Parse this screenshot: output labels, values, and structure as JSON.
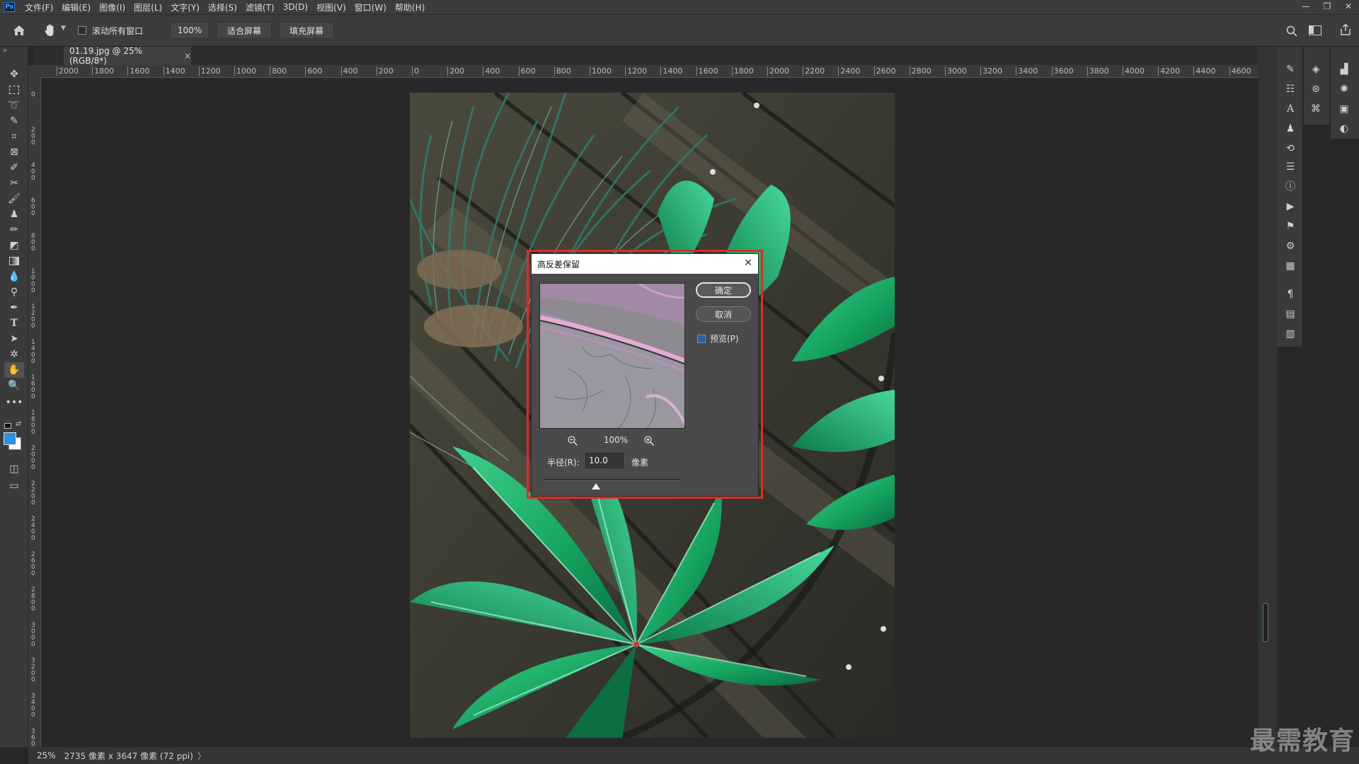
{
  "app": {
    "logo": "Ps"
  },
  "menu": [
    "文件(F)",
    "编辑(E)",
    "图像(I)",
    "图层(L)",
    "文字(Y)",
    "选择(S)",
    "滤镜(T)",
    "3D(D)",
    "视图(V)",
    "窗口(W)",
    "帮助(H)"
  ],
  "window_controls": {
    "minimize": "—",
    "restore": "❐",
    "close": "✕"
  },
  "options": {
    "scroll_all_label": "滚动所有窗口",
    "scroll_all_checked": false,
    "zoom_value": "100%",
    "fit_screen": "适合屏幕",
    "fill_screen": "填充屏幕"
  },
  "document": {
    "tab_title": "01.19.jpg @ 25%(RGB/8*)",
    "tab_close": "×"
  },
  "h_ruler_labels": [
    "2000",
    "1800",
    "1600",
    "1400",
    "1200",
    "1000",
    "800",
    "600",
    "400",
    "200",
    "0",
    "200",
    "400",
    "600",
    "800",
    "1000",
    "1200",
    "1400",
    "1600",
    "1800",
    "2000",
    "2200",
    "2400",
    "2600",
    "2800",
    "3000",
    "3200",
    "3400",
    "3600",
    "3800",
    "4000",
    "4200",
    "4400",
    "4600"
  ],
  "v_ruler_labels": [
    "0",
    "200",
    "400",
    "600",
    "800",
    "1000",
    "1200",
    "1400",
    "1600",
    "1800",
    "2000",
    "2200",
    "2400",
    "2600",
    "2800",
    "3000",
    "3200",
    "3400",
    "3600"
  ],
  "status": {
    "zoom": "25%",
    "info": "2735 像素 x 3647 像素 (72 ppi)",
    "arrow": "〉"
  },
  "dialog": {
    "title": "高反差保留",
    "close": "✕",
    "ok": "确定",
    "cancel": "取消",
    "preview_label": "预览(P)",
    "preview_checked": true,
    "zoom_percent": "100%",
    "radius_label": "半径(R):",
    "radius_value": "10.0",
    "unit": "像素",
    "slider_fraction": 0.38
  },
  "watermark": "最需教育",
  "colors": {
    "accent": "#2b7bd6",
    "highlight": "#e02a2a",
    "foreground": "#2f8fe0",
    "background": "#ffffff"
  }
}
